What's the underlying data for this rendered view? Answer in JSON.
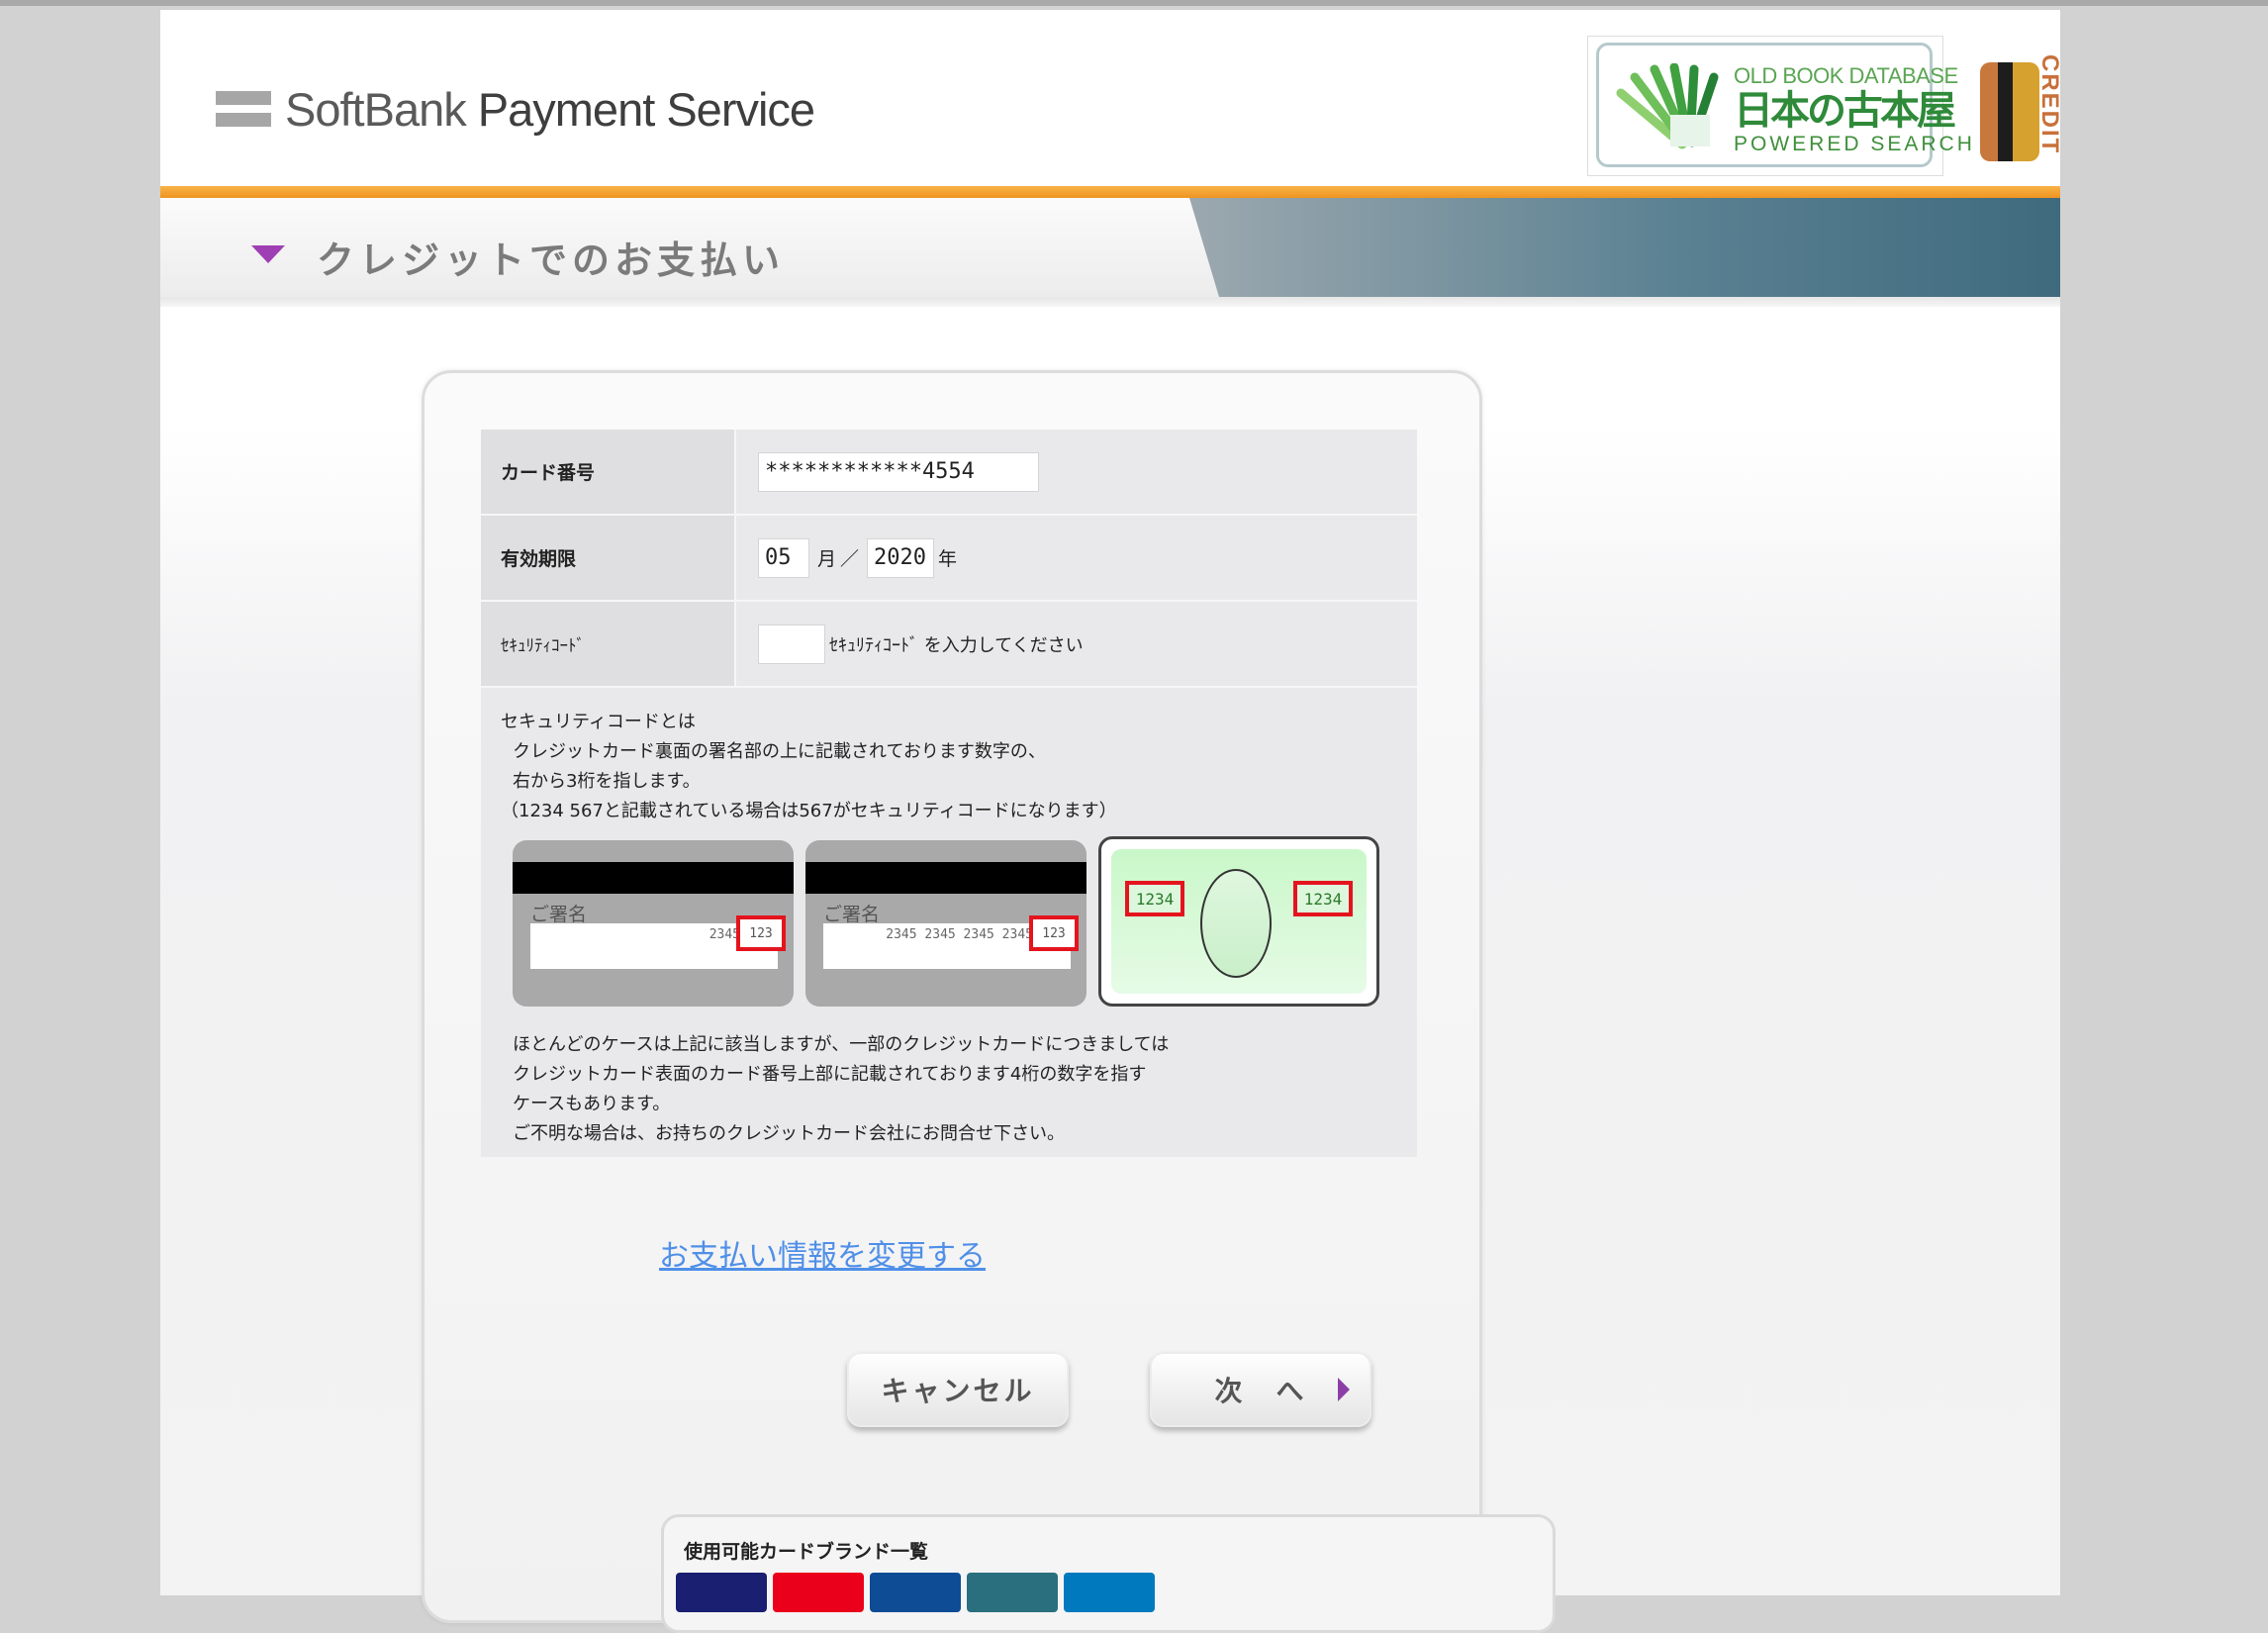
{
  "header": {
    "logo_light": "SoftBank",
    "logo_bold": "Payment Service",
    "badge": {
      "line1": "OLD BOOK DATABASE",
      "line2": "日本の古本屋",
      "line3": "POWERED SEARCH",
      "credit": "CREDIT"
    }
  },
  "title": "クレジットでのお支払い",
  "form": {
    "card_number_label": "カード番号",
    "card_number_value": "************4554",
    "expiry_label": "有効期限",
    "expiry_month": "05",
    "month_unit": "月",
    "slash": "／",
    "expiry_year": "2020",
    "year_unit": "年",
    "security_label": "ｾｷｭﾘﾃｨｺｰﾄﾞ",
    "security_value": "",
    "security_hint": "ｾｷｭﾘﾃｨｺｰﾄﾞ を入力してください"
  },
  "info": {
    "heading": "セキュリティコードとは",
    "line1": "クレジットカード裏面の署名部の上に記載されております数字の、",
    "line2": "右から3桁を指します。",
    "line3": "（1234 567と記載されている場合は567がセキュリティコードになります）",
    "card1": {
      "sig": "ご署名",
      "num": "2345",
      "code": "123"
    },
    "card2": {
      "sig": "ご署名",
      "num": "2345 2345 2345 2345",
      "code": "123"
    },
    "card3": {
      "left": "1234",
      "right": "1234"
    },
    "after1": "ほとんどのケースは上記に該当しますが、一部のクレジットカードにつきましては",
    "after2": "クレジットカード表面のカード番号上部に記載されております4桁の数字を指す",
    "after3": "ケースもあります。",
    "after4": "ご不明な場合は、お持ちのクレジットカード会社にお問合せ下さい。"
  },
  "change_link": "お支払い情報を変更する",
  "buttons": {
    "cancel": "キャンセル",
    "next": "次　へ"
  },
  "brands": {
    "title": "使用可能カードブランド一覧",
    "colors": [
      "#1a1f71",
      "#eb001b",
      "#0e4c96",
      "#2a6f7e",
      "#0079be"
    ]
  }
}
